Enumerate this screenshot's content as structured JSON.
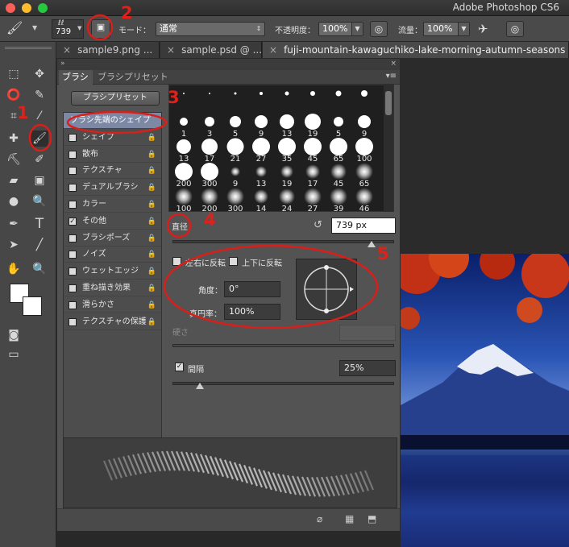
{
  "window": {
    "title": "Adobe Photoshop CS6"
  },
  "options_bar": {
    "brush_size": "739",
    "mode_label": "モード：",
    "mode_value": "通常",
    "opacity_label": "不透明度：",
    "opacity_value": "100%",
    "flow_label": "流量：",
    "flow_value": "100%"
  },
  "document_tabs": [
    "sample9.png ...",
    "sample.psd @ ...",
    "fuji-mountain-kawaguchiko-lake-morning-autumn-seasons"
  ],
  "panel": {
    "tabs": [
      "ブラシ",
      "ブラシプリセット"
    ],
    "preset_button": "ブラシプリセット",
    "categories": [
      {
        "label": "ブラシ先端のシェイプ",
        "checkbox": false,
        "lock": false,
        "selected": true
      },
      {
        "label": "シェイプ",
        "checkbox": true,
        "checked": false,
        "lock": true
      },
      {
        "label": "散布",
        "checkbox": true,
        "checked": false,
        "lock": true
      },
      {
        "label": "テクスチャ",
        "checkbox": true,
        "checked": false,
        "lock": true
      },
      {
        "label": "デュアルブラシ",
        "checkbox": true,
        "checked": false,
        "lock": true
      },
      {
        "label": "カラー",
        "checkbox": true,
        "checked": false,
        "lock": true
      },
      {
        "label": "その他",
        "checkbox": true,
        "checked": true,
        "lock": true
      },
      {
        "label": "ブラシポーズ",
        "checkbox": true,
        "checked": false,
        "lock": true
      },
      {
        "label": "ノイズ",
        "checkbox": true,
        "checked": false,
        "lock": true
      },
      {
        "label": "ウェットエッジ",
        "checkbox": true,
        "checked": false,
        "lock": true
      },
      {
        "label": "重ね描き効果",
        "checkbox": true,
        "checked": false,
        "lock": true
      },
      {
        "label": "滑らかさ",
        "checkbox": true,
        "checked": false,
        "lock": true
      },
      {
        "label": "テクスチャの保護",
        "checkbox": true,
        "checked": false,
        "lock": true
      }
    ],
    "brush_tips": [
      {
        "n": "",
        "d": 2,
        "soft": false
      },
      {
        "n": "",
        "d": 2,
        "soft": false
      },
      {
        "n": "",
        "d": 3,
        "soft": false
      },
      {
        "n": "",
        "d": 4,
        "soft": false
      },
      {
        "n": "",
        "d": 5,
        "soft": false
      },
      {
        "n": "",
        "d": 6,
        "soft": false
      },
      {
        "n": "",
        "d": 7,
        "soft": false
      },
      {
        "n": "",
        "d": 8,
        "soft": false
      },
      {
        "n": "1",
        "d": 10,
        "soft": false
      },
      {
        "n": "3",
        "d": 12,
        "soft": false
      },
      {
        "n": "5",
        "d": 14,
        "soft": false
      },
      {
        "n": "9",
        "d": 16,
        "soft": false
      },
      {
        "n": "13",
        "d": 18,
        "soft": false
      },
      {
        "n": "19",
        "d": 20,
        "soft": false
      },
      {
        "n": "5",
        "d": 12,
        "soft": false
      },
      {
        "n": "9",
        "d": 16,
        "soft": false
      },
      {
        "n": "13",
        "d": 18,
        "soft": false
      },
      {
        "n": "17",
        "d": 20,
        "soft": false
      },
      {
        "n": "21",
        "d": 21,
        "soft": false
      },
      {
        "n": "27",
        "d": 22,
        "soft": false
      },
      {
        "n": "35",
        "d": 23,
        "soft": false
      },
      {
        "n": "45",
        "d": 24,
        "soft": false
      },
      {
        "n": "65",
        "d": 25,
        "soft": false
      },
      {
        "n": "100",
        "d": 26,
        "soft": false
      },
      {
        "n": "200",
        "d": 26,
        "soft": false
      },
      {
        "n": "300",
        "d": 26,
        "soft": false
      },
      {
        "n": "9",
        "d": 12,
        "soft": true
      },
      {
        "n": "13",
        "d": 14,
        "soft": true
      },
      {
        "n": "19",
        "d": 16,
        "soft": true
      },
      {
        "n": "17",
        "d": 18,
        "soft": true
      },
      {
        "n": "45",
        "d": 20,
        "soft": true
      },
      {
        "n": "65",
        "d": 22,
        "soft": true
      },
      {
        "n": "100",
        "d": 24,
        "soft": true
      },
      {
        "n": "200",
        "d": 24,
        "soft": true
      },
      {
        "n": "300",
        "d": 24,
        "soft": true
      },
      {
        "n": "14",
        "d": 18,
        "soft": true
      },
      {
        "n": "24",
        "d": 20,
        "soft": true
      },
      {
        "n": "27",
        "d": 22,
        "soft": true
      },
      {
        "n": "39",
        "d": 22,
        "soft": true
      },
      {
        "n": "46",
        "d": 24,
        "soft": true
      }
    ],
    "diameter_label": "直径",
    "diameter_value": "739 px",
    "flip_x_label": "左右に反転",
    "flip_y_label": "上下に反転",
    "angle_label": "角度：",
    "angle_value": "0°",
    "roundness_label": "真円率：",
    "roundness_value": "100%",
    "hardness_label": "硬さ",
    "spacing_label": "間隔",
    "spacing_checked": true,
    "spacing_value": "25%"
  },
  "annotations": [
    "1",
    "2",
    "3",
    "4",
    "5"
  ]
}
